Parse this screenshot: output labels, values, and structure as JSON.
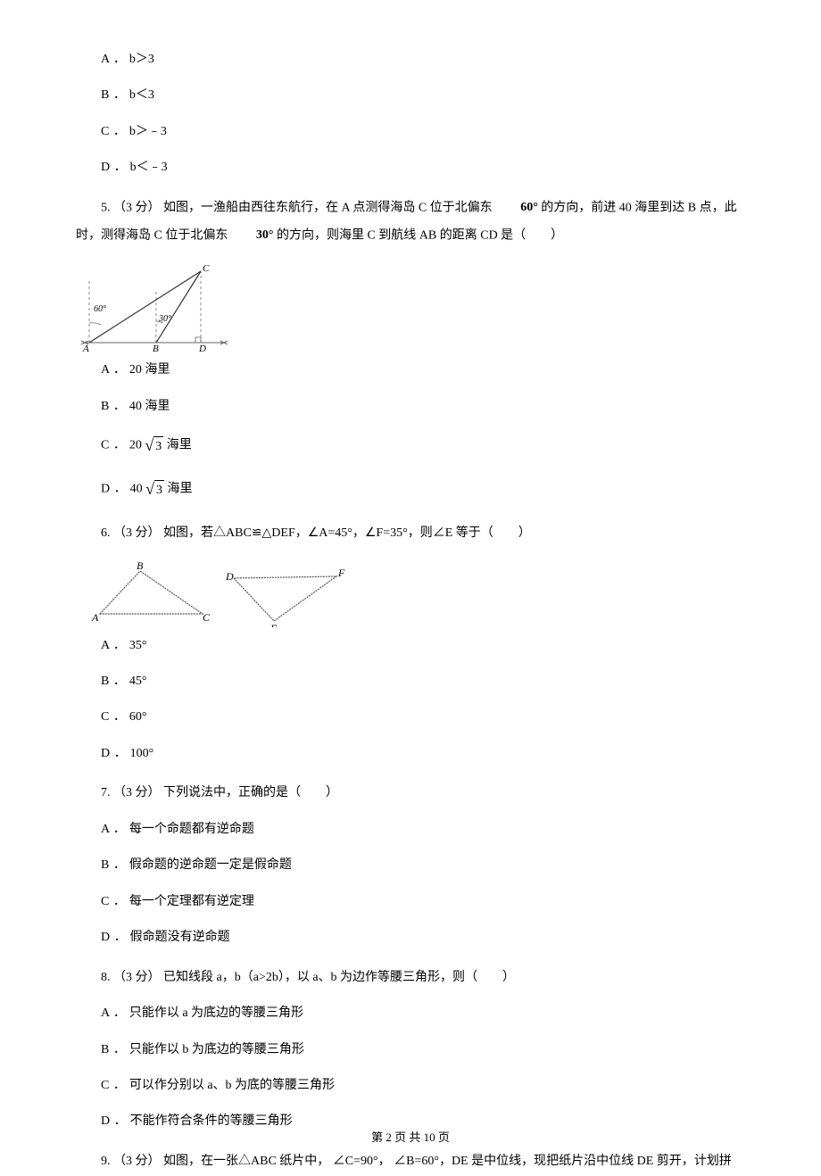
{
  "q4_options": {
    "A": "b＞3",
    "B": "b＜3",
    "C": "b＞﹣3",
    "D": "b＜﹣3"
  },
  "q5": {
    "prefix": "5.",
    "points": "（3 分）",
    "text_part1": " 如图，一渔船由西往东航行，在 A 点测得海岛 C 位于北偏东 ",
    "deg1": "60°",
    "text_part2": " 的方向，前进 40 海里到达 B 点，此时，测得海岛 C 位于北偏东 ",
    "deg2": "30°",
    "text_part3": " 的方向，则海里 C 到航线 AB 的距离 CD 是（　　）",
    "options": {
      "A": "20 海里",
      "B": "40 海里",
      "C_pre": "20 ",
      "C_sqrt": "3",
      "C_post": " 海里",
      "D_pre": "40 ",
      "D_sqrt": "3",
      "D_post": " 海里"
    }
  },
  "q6": {
    "prefix": "6.",
    "points": "（3 分）",
    "text": " 如图，若△ABC≌△DEF，∠A=45°，∠F=35°，则∠E 等于（　　）",
    "options": {
      "A": "35°",
      "B": "45°",
      "C": "60°",
      "D": "100°"
    }
  },
  "q7": {
    "prefix": "7.",
    "points": "（3 分）",
    "text": " 下列说法中，正确的是（　　）",
    "options": {
      "A": "每一个命题都有逆命题",
      "B": "假命题的逆命题一定是假命题",
      "C": "每一个定理都有逆定理",
      "D": "假命题没有逆命题"
    }
  },
  "q8": {
    "prefix": "8.",
    "points": "（3 分）",
    "text": " 已知线段 a，b（a>2b），以 a、b 为边作等腰三角形，则（　　）",
    "options": {
      "A": "只能作以 a 为底边的等腰三角形",
      "B": "只能作以 b 为底边的等腰三角形",
      "C": "可以作分别以 a、b 为底的等腰三角形",
      "D": "不能作符合条件的等腰三角形"
    }
  },
  "q9": {
    "prefix": "9.",
    "points": "（3 分）",
    "text": " 如图，在一张△ABC 纸片中， ∠C=90°， ∠B=60°，DE 是中位线，现把纸片沿中位线 DE 剪开，计划拼"
  },
  "footer": "第 2 页 共 10 页",
  "labels": {
    "A": "A ．",
    "B": "B ．",
    "C": "C ．",
    "D": "D ．"
  }
}
